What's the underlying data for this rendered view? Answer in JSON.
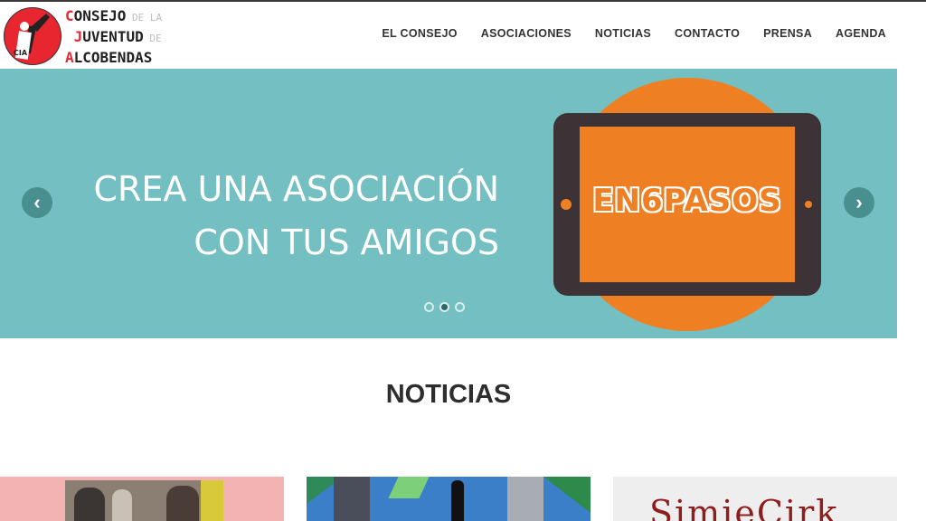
{
  "header": {
    "logo": {
      "lines": [
        {
          "first": "C",
          "rest": "ONSEJO",
          "small": " DE LA"
        },
        {
          "first": "J",
          "rest": "UVENTUD",
          "small": " DE"
        },
        {
          "first": "A",
          "rest": "LCOBENDAS",
          "small": ""
        }
      ],
      "badge": "CIA"
    },
    "nav": [
      {
        "label": "EL CONSEJO"
      },
      {
        "label": "ASOCIACIONES"
      },
      {
        "label": "NOTICIAS"
      },
      {
        "label": "CONTACTO"
      },
      {
        "label": "PRENSA"
      },
      {
        "label": "AGENDA"
      }
    ]
  },
  "slider": {
    "headline_line1": "CREA UNA ASOCIACIÓN",
    "headline_line2": "CON TUS AMIGOS",
    "tablet_text": "EN6PASOS",
    "prev_icon": "‹",
    "next_icon": "›",
    "active_dot": 2,
    "dot_count": 3,
    "colors": {
      "background": "#74bfc2",
      "accent": "#ef7f23",
      "tablet": "#3d3336"
    }
  },
  "news": {
    "title": "NOTICIAS",
    "card3_text": "SimieCirk"
  }
}
